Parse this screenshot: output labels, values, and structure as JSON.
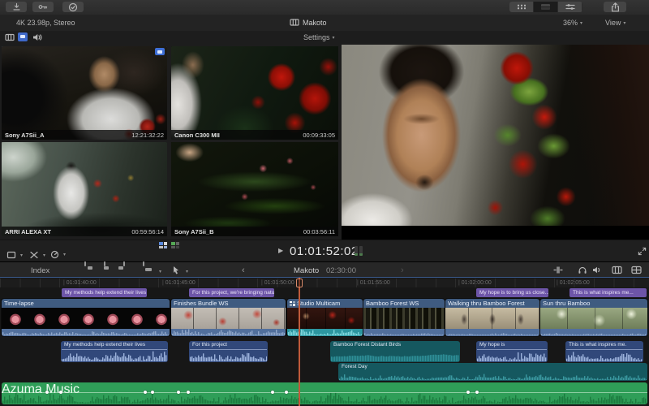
{
  "header": {
    "format_label": "4K 23.98p, Stereo",
    "project_title": "Makoto",
    "zoom_level": "36%",
    "view_label": "View"
  },
  "icons": {
    "chevron": "▾",
    "play": "▶",
    "back": "‹",
    "forward": "›"
  },
  "angle_viewer": {
    "settings_label": "Settings",
    "angles": [
      {
        "name": "Sony A7Sii_A",
        "timecode": "12:21:32:22"
      },
      {
        "name": "Canon C300 MII",
        "timecode": "00:09:33:05"
      },
      {
        "name": "ARRI ALEXA XT",
        "timecode": "00:59:56:14"
      },
      {
        "name": "Sony A7Sii_B",
        "timecode": "00:03:56:11"
      }
    ]
  },
  "transport": {
    "timecode": "01:01:52:02"
  },
  "timeline_toolbar": {
    "index_label": "Index",
    "project_name": "Makoto",
    "project_duration": "02:30:00"
  },
  "ruler": {
    "labels": [
      "01:01:40:00",
      "01:01:45:00",
      "01:01:50:00",
      "01:01:55:00",
      "01:02:00:00",
      "01:02:05:00"
    ]
  },
  "timeline": {
    "captions": [
      {
        "text": "My methods help extend their lives"
      },
      {
        "text": "For this project, we're bringing nature..."
      },
      {
        "text": "My hope is to bring us close..."
      },
      {
        "text": "This is what inspires me..."
      }
    ],
    "video_clips": [
      {
        "name": "Time-lapse"
      },
      {
        "name": "Finishes Bundle WS"
      },
      {
        "name": "Studio Multicam"
      },
      {
        "name": "Bamboo Forest WS"
      },
      {
        "name": "Walking thru Bamboo Forest"
      },
      {
        "name": "Sun thru Bamboo"
      }
    ],
    "audio_clips": [
      {
        "name": "My methods help extend their lives"
      },
      {
        "name": "For this project"
      },
      {
        "name": "Bamboo Forest Distant Birds"
      },
      {
        "name": "My hope is"
      },
      {
        "name": "This is what inspires me."
      }
    ],
    "sfx_clip": {
      "name": "Forest Day"
    },
    "music_clip": {
      "name": "Azuma Music",
      "keyframes": [
        0.07,
        0.092,
        0.222,
        0.234,
        0.274,
        0.289,
        0.42,
        0.441,
        0.722,
        0.736
      ]
    }
  },
  "colors": {
    "accent_blue": "#4a86d8",
    "caption_purple": "#6d55a8",
    "clip_blue": "#3f5b80",
    "audio_blue": "#31487a",
    "sfx_teal": "#15585f",
    "music_green": "#2f9e58",
    "playhead": "#c05a3a"
  }
}
